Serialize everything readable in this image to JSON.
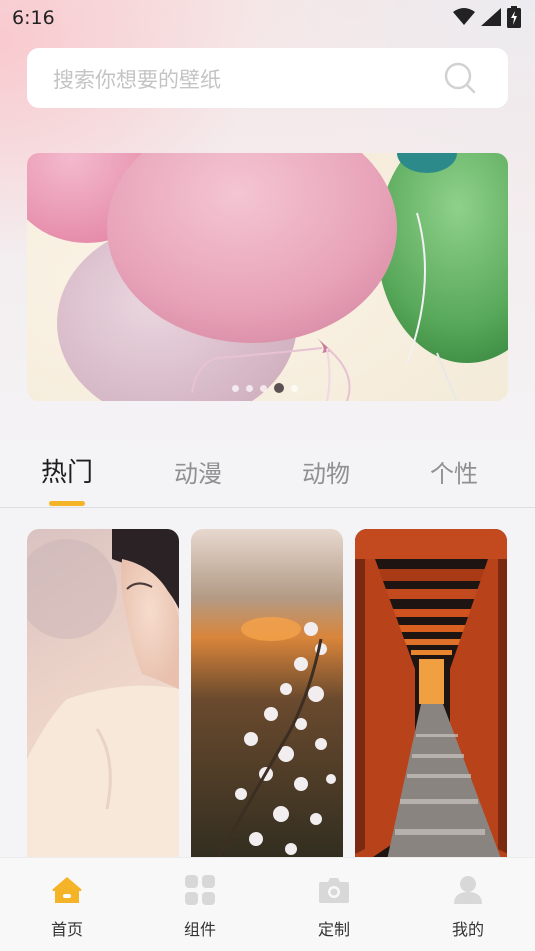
{
  "status_bar": {
    "time": "6:16"
  },
  "search": {
    "placeholder": "搜索你想要的壁纸"
  },
  "banner": {
    "dots": 5,
    "active_dot": 3
  },
  "tabs": [
    {
      "label": "热门",
      "active": true
    },
    {
      "label": "动漫",
      "active": false
    },
    {
      "label": "动物",
      "active": false
    },
    {
      "label": "个性",
      "active": false
    }
  ],
  "wallpapers": [
    "portrait",
    "cherry-blossom-sunset",
    "torii-gates"
  ],
  "bottom_nav": [
    {
      "label": "首页",
      "icon": "home-icon",
      "active": true
    },
    {
      "label": "组件",
      "icon": "widgets-icon",
      "active": false
    },
    {
      "label": "定制",
      "icon": "camera-icon",
      "active": false
    },
    {
      "label": "我的",
      "icon": "user-icon",
      "active": false
    }
  ],
  "colors": {
    "accent": "#f5b428",
    "inactive_icon": "#d8d8d8"
  }
}
